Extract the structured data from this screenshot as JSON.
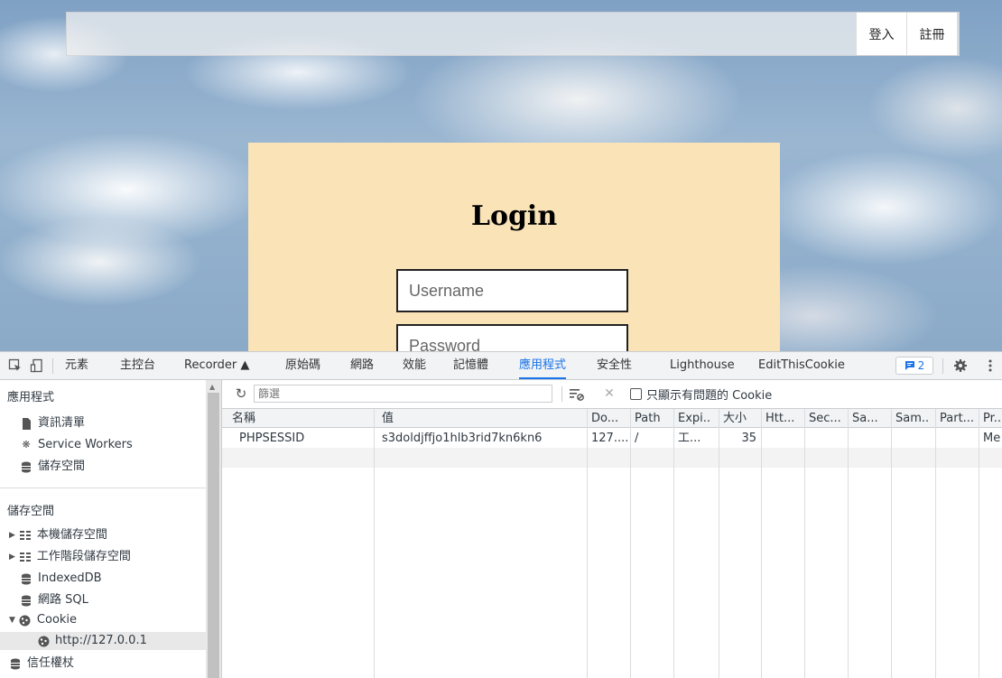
{
  "page": {
    "nav": {
      "login": "登入",
      "register": "註冊"
    },
    "login": {
      "title": "Login",
      "username_placeholder": "Username",
      "password_placeholder": "Password"
    }
  },
  "devtools": {
    "tabs": [
      "元素",
      "主控台",
      "Recorder",
      "原始碼",
      "網路",
      "效能",
      "記憶體",
      "應用程式",
      "安全性",
      "Lighthouse",
      "EditThisCookie"
    ],
    "active_tab": "應用程式",
    "issues_count": "2",
    "sidebar": {
      "app_heading": "應用程式",
      "app_items": [
        "資訊清單",
        "Service Workers",
        "儲存空間"
      ],
      "storage_heading": "儲存空間",
      "storage_items": [
        "本機儲存空間",
        "工作階段儲存空間",
        "IndexedDB",
        "網路 SQL",
        "Cookie",
        "http://127.0.0.1",
        "信任權杖"
      ]
    },
    "toolbar": {
      "filter_placeholder": "篩選",
      "only_issues_label": "只顯示有問題的 Cookie"
    },
    "table": {
      "columns": [
        "名稱",
        "值",
        "Do...",
        "Path",
        "Expi..",
        "大小",
        "Htt...",
        "Sec...",
        "Sa...",
        "Sam..",
        "Part...",
        "Pr..."
      ],
      "rows": [
        [
          "PHPSESSID",
          "s3doldjffjo1hlb3rid7kn6kn6",
          "127....",
          "/",
          "工...",
          "35",
          "",
          "",
          "",
          "",
          "",
          "Me"
        ]
      ]
    }
  }
}
